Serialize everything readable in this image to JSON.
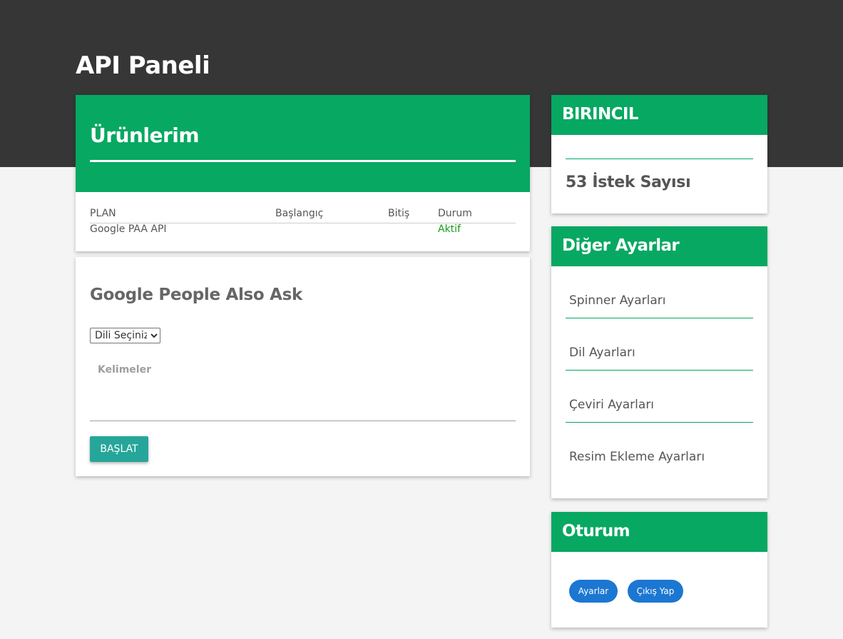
{
  "header": {
    "title": "API Paneli"
  },
  "products": {
    "title": "Ürünlerim",
    "columns": [
      "PLAN",
      "Başlangıç",
      "Bitiş",
      "Durum"
    ],
    "rows": [
      {
        "plan": "Google PAA API",
        "start": "",
        "end": "",
        "status": "Aktif"
      }
    ]
  },
  "paa": {
    "title": "Google People Also Ask",
    "language_select": {
      "selected": "Dili Seçiniz"
    },
    "keywords": {
      "placeholder": "Kelimeler",
      "value": ""
    },
    "start_label": "BAŞLAT"
  },
  "primary": {
    "title": "BIRINCIL",
    "request_count": "53 İstek Sayısı"
  },
  "settings": {
    "title": "Diğer Ayarlar",
    "items": [
      {
        "label": "Spinner Ayarları"
      },
      {
        "label": "Dil Ayarları"
      },
      {
        "label": "Çeviri Ayarları"
      },
      {
        "label": "Resim Ekleme Ayarları"
      }
    ]
  },
  "session": {
    "title": "Oturum",
    "settings_label": "Ayarlar",
    "logout_label": "Çıkış Yap"
  },
  "colors": {
    "header_bg": "#363636",
    "accent_green": "#07a862",
    "teal_button": "#26a69a",
    "blue_pill": "#1b77d2",
    "status_active": "#1a9a1a"
  }
}
